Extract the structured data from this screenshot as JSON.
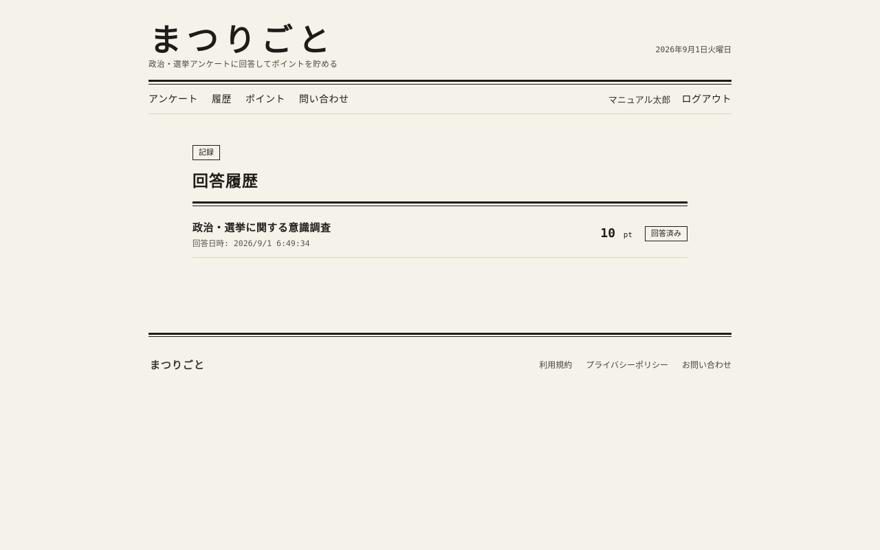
{
  "header": {
    "site_title": "まつりごと",
    "tagline": "政治・選挙アンケートに回答してポイントを貯める",
    "date": "2026年9月1日火曜日"
  },
  "nav": {
    "items": [
      {
        "label": "アンケート"
      },
      {
        "label": "履歴"
      },
      {
        "label": "ポイント"
      },
      {
        "label": "問い合わせ"
      }
    ],
    "user_name": "マニュアル太郎",
    "logout_label": "ログアウト"
  },
  "main": {
    "section_badge": "記録",
    "page_title": "回答履歴",
    "history": [
      {
        "survey_title": "政治・選挙に関する意識調査",
        "answered_at": "回答日時: 2026/9/1 6:49:34",
        "points": "10",
        "points_unit": "pt",
        "status": "回答済み"
      }
    ]
  },
  "footer": {
    "brand": "まつりごと",
    "links": [
      {
        "label": "利用規約"
      },
      {
        "label": "プライバシーポリシー"
      },
      {
        "label": "お問い合わせ"
      }
    ]
  }
}
